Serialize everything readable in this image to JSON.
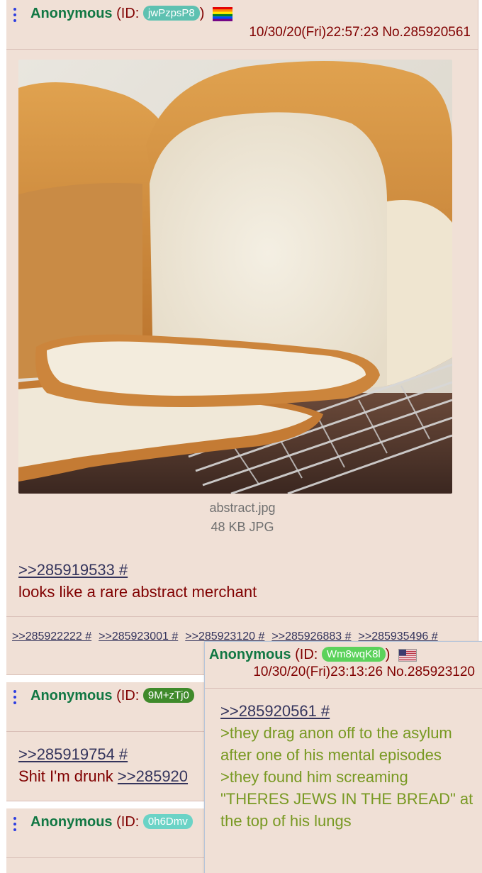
{
  "op": {
    "name": "Anonymous",
    "id_prefix": "(ID: ",
    "id": "jwPzpsP8",
    "id_color": "#5ec1b1",
    "id_suffix": ")",
    "flag": "rainbow-flag-icon",
    "date": "10/30/20(Fri)22:57:23",
    "no": "No.285920561",
    "file_name": "abstract.jpg",
    "file_size": "48 KB JPG",
    "quote": ">>285919533 #",
    "text": "looks like a rare abstract merchant",
    "backlinks": [
      ">>285922222 #",
      ">>285923001 #",
      ">>285923120 #",
      ">>285926883 #",
      ">>285935496 #"
    ]
  },
  "reply1": {
    "name": "Anonymous",
    "id_prefix": "(ID: ",
    "id": "9M+zTj0",
    "id_color": "#3f8a2b",
    "quote": ">>285919754 #",
    "text": "Shit I'm drunk ",
    "inline_quote": ">>285920"
  },
  "reply2": {
    "name": "Anonymous",
    "id_prefix": "(ID: ",
    "id": "0h6Dmv",
    "id_color": "#6bd3c6"
  },
  "hover": {
    "name": "Anonymous",
    "id_prefix": "(ID: ",
    "id": "Wm8wqK8l",
    "id_color": "#5bd25b",
    "id_suffix": ")",
    "flag": "us-flag-icon",
    "date": "10/30/20(Fri)23:13:26",
    "no": "No.285923120",
    "quote": ">>285920561 #",
    "greentext": [
      ">they drag anon off to the asylum after one of his mental episodes",
      ">they found him screaming \"THERES JEWS IN THE BREAD\" at the top of his lungs"
    ]
  },
  "colors": {
    "post_bg": "#f0e0d6",
    "name": "#117743",
    "text": "#800000",
    "link": "#34345c",
    "greentext": "#789922"
  }
}
